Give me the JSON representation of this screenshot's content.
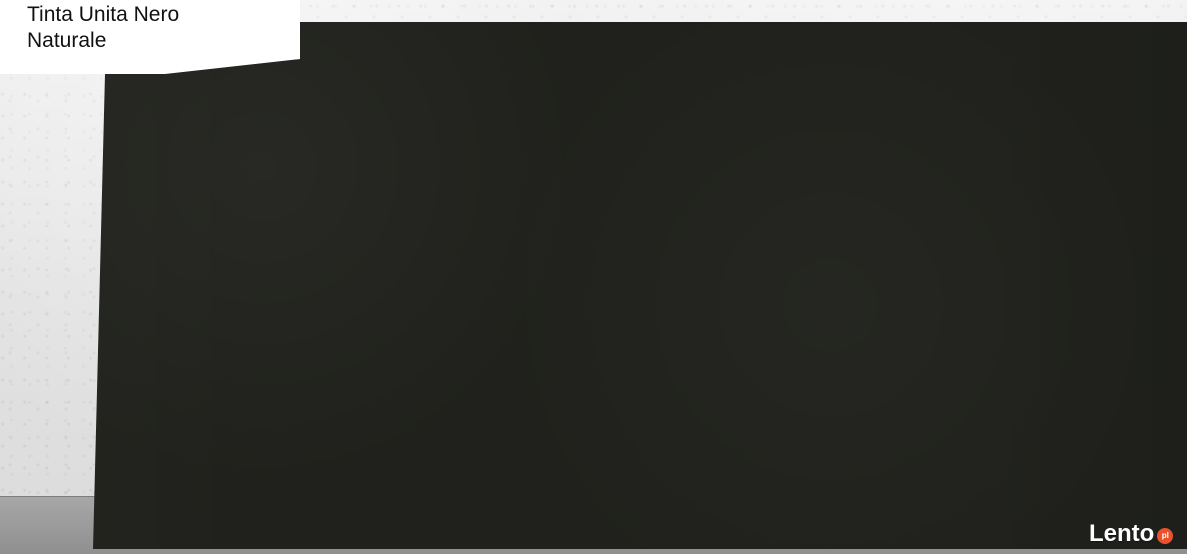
{
  "label": {
    "line1": "Tinta Unita Nero",
    "line2": "Naturale"
  },
  "watermark": {
    "text": "Lento",
    "badge": "pl"
  },
  "colors": {
    "slab": "#20211c",
    "label_background": "#ffffff",
    "watermark_badge": "#e8532d"
  }
}
